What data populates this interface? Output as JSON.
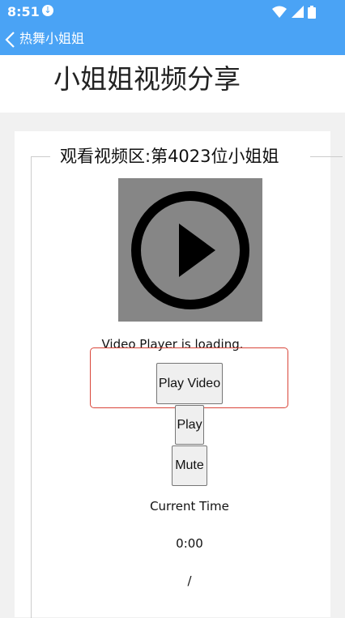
{
  "status_bar": {
    "time": "8:51",
    "download_icon": "download-icon",
    "icons": [
      "wifi-icon",
      "signal-icon",
      "battery-icon"
    ]
  },
  "titlebar": {
    "back_icon": "chevron-left-icon",
    "title": "热舞小姐姐"
  },
  "header": {
    "page_title": "小姐姐视频分享"
  },
  "video_section": {
    "legend": "观看视频区:第4023位小姐姐",
    "thumbnail_icon": "play-circle-icon",
    "loading_text": "Video Player is loading.",
    "play_video_label": "Play Video",
    "play_label": "Play",
    "mute_label": "Mute",
    "current_time_label": "Current Time",
    "current_time_value": "0:00",
    "separator": "/"
  },
  "colors": {
    "accent": "#4aa3f5",
    "highlight": "#d9463a",
    "thumbnail_bg": "#868686"
  }
}
